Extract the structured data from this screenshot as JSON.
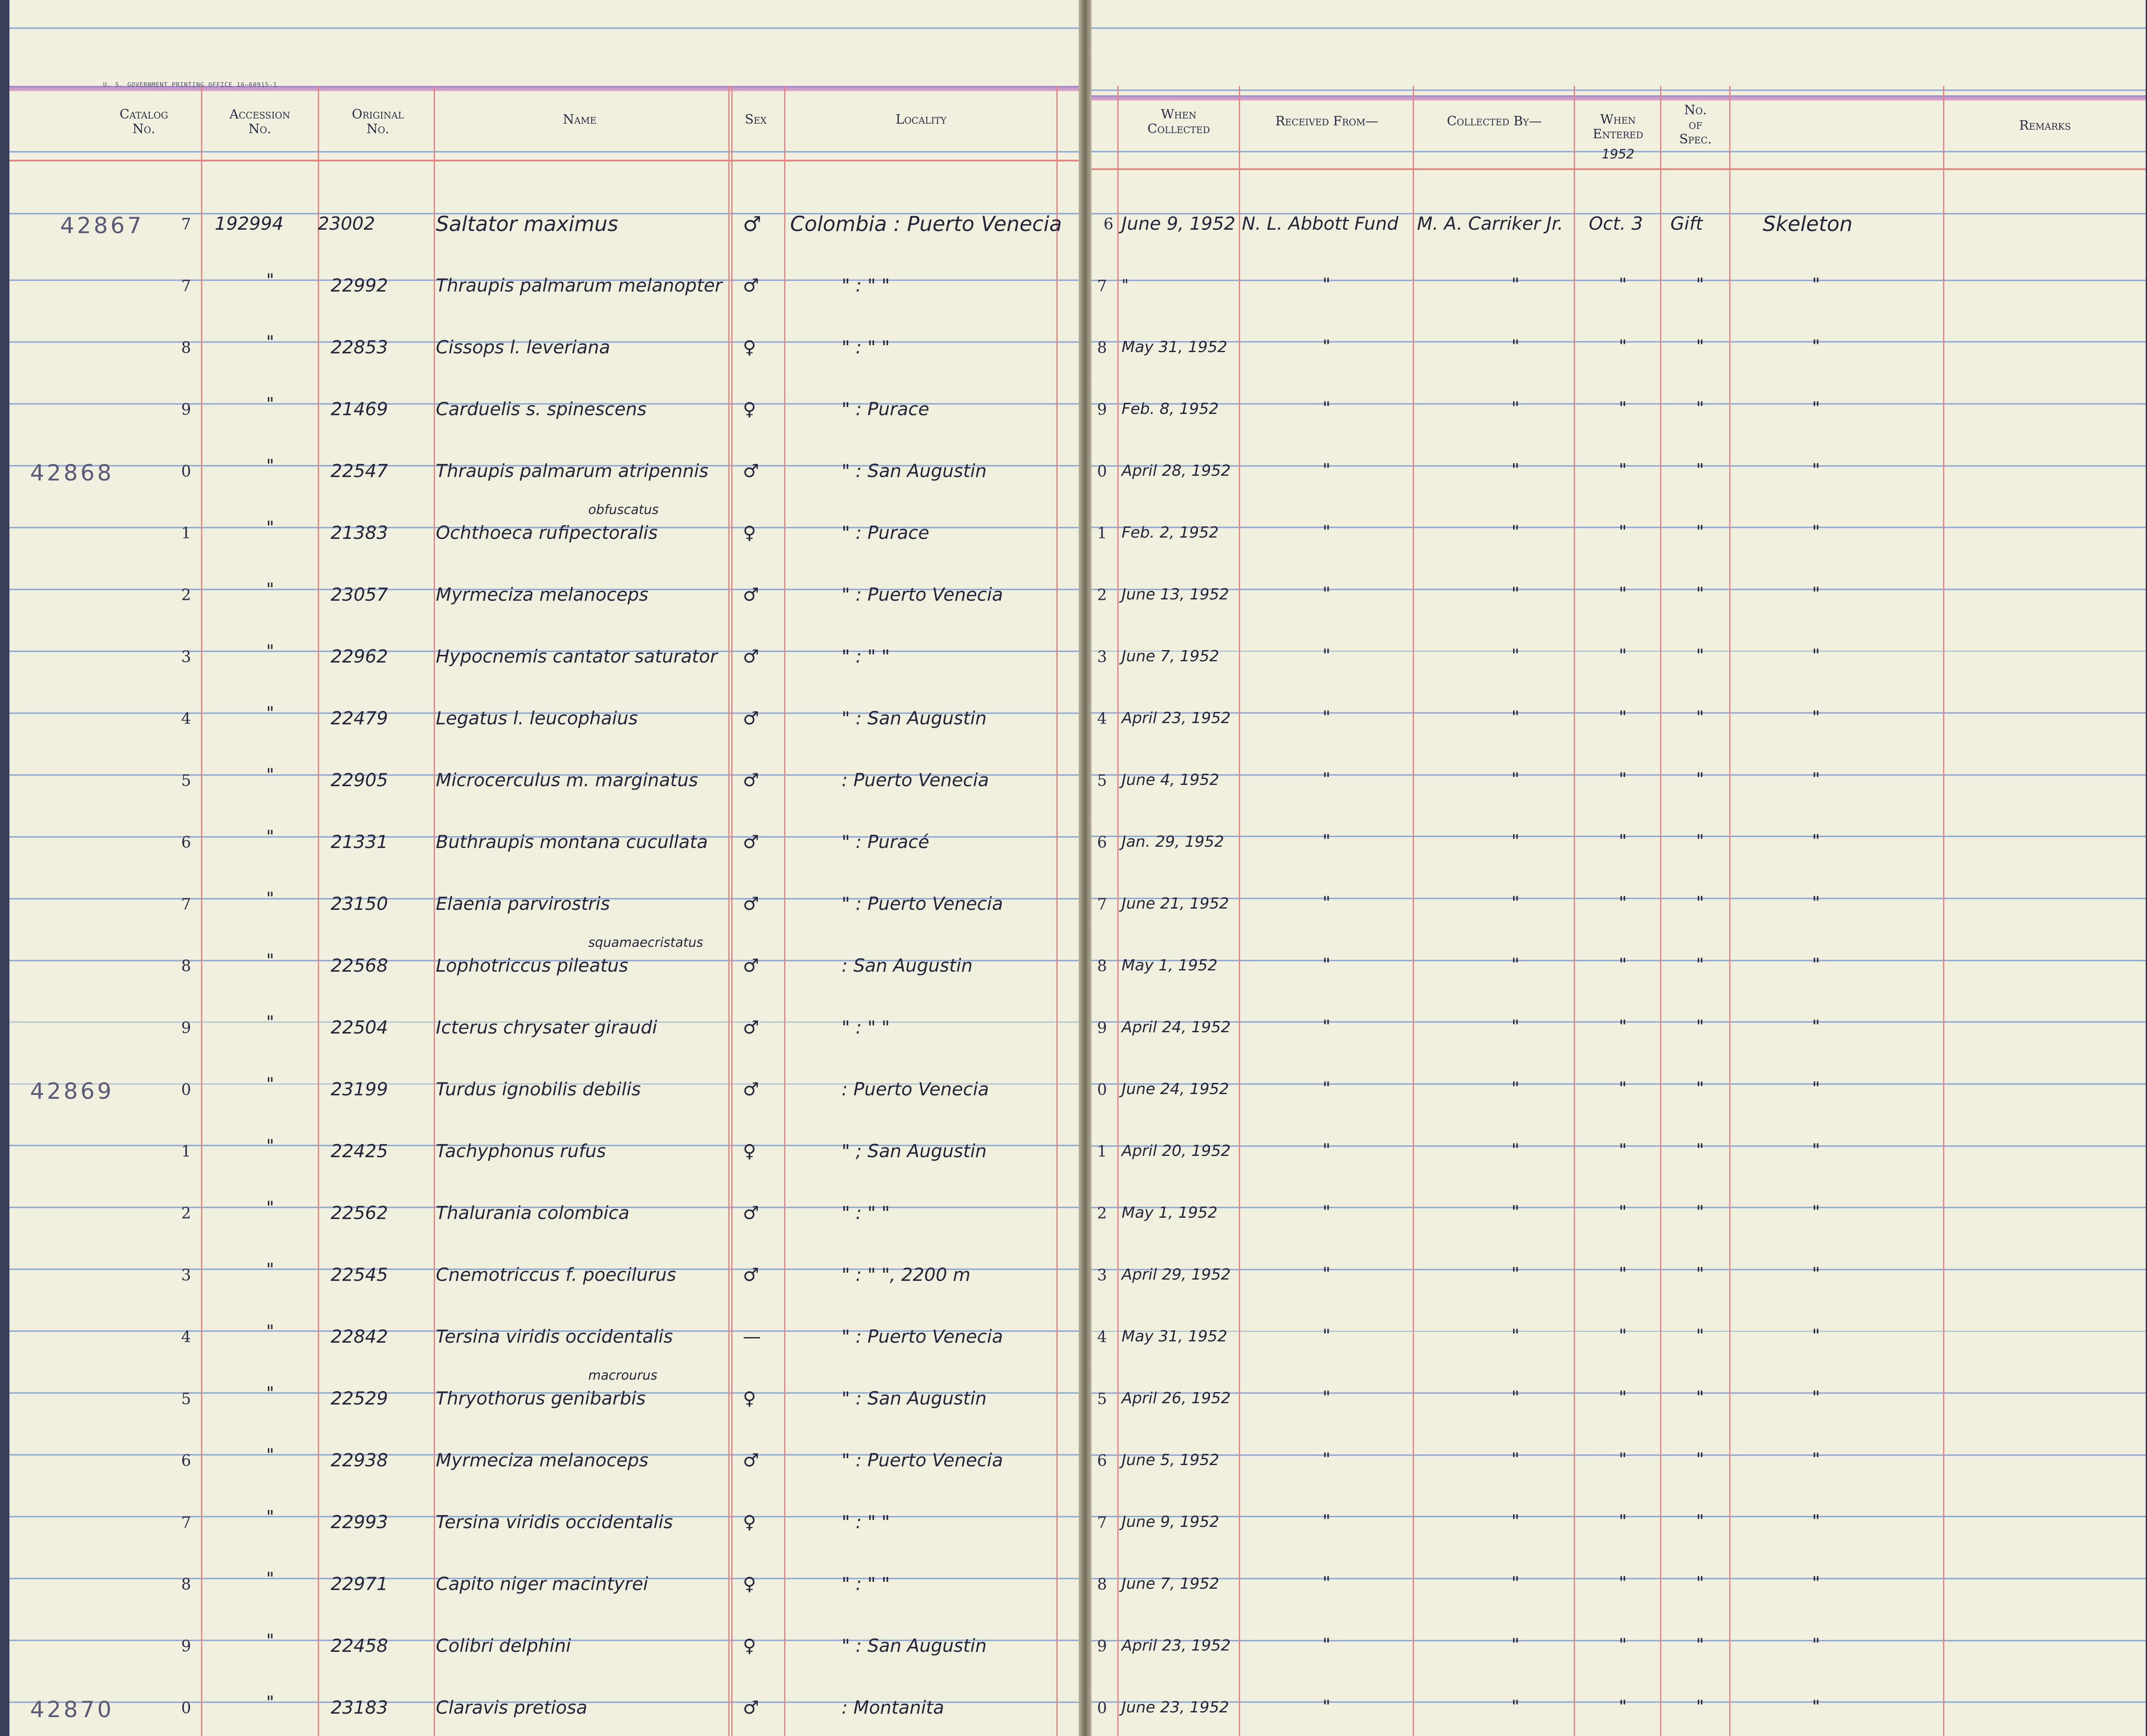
{
  "printer_line": "U. S. GOVERNMENT PRINTING OFFICE   16—60915-1",
  "headers": {
    "catalog": "Catalog\nNo.",
    "accession": "Accession\nNo.",
    "original": "Original\nNo.",
    "name": "Name",
    "sex": "Sex",
    "locality": "Locality",
    "when_collected": "When\nCollected",
    "received_from": "Received From—",
    "collected_by": "Collected By—",
    "when_entered": "When\nEntered",
    "no_of_spec": "No.\nof\nSpec.",
    "remarks": "Remarks"
  },
  "entered_year": "1952",
  "first_row": {
    "catalog_prefix": "42867",
    "accession": "192994",
    "original": "23002",
    "name": "Saltator maximus",
    "sex": "♂",
    "locality": "Colombia : Puerto Venecia",
    "right_digit": "6",
    "when_collected": "June 9, 1952",
    "received_from": "N. L. Abbott Fund",
    "collected_by": "M. A. Carriker Jr.",
    "when_entered": "Oct. 3",
    "spec": "Gift",
    "remarks": "Skeleton"
  },
  "rows": [
    {
      "catalog_prefix": "",
      "digit": "7",
      "original": "22992",
      "name": "Thraupis palmarum melanopter",
      "sex": "♂",
      "locality": "\"   :   \"   \"",
      "when_collected": "\""
    },
    {
      "catalog_prefix": "",
      "digit": "8",
      "original": "22853",
      "name": "Cissops l. leveriana",
      "sex": "♀",
      "locality": "\"   :   \"   \"",
      "when_collected": "May 31, 1952"
    },
    {
      "catalog_prefix": "",
      "digit": "9",
      "original": "21469",
      "name": "Carduelis s. spinescens",
      "sex": "♀",
      "locality": "\"  :  Purace",
      "when_collected": "Feb. 8, 1952"
    },
    {
      "catalog_prefix": "42868",
      "digit": "0",
      "original": "22547",
      "name": "Thraupis palmarum atripennis",
      "sex": "♂",
      "locality": "\"  :  San Augustin",
      "when_collected": "April 28, 1952"
    },
    {
      "catalog_prefix": "",
      "digit": "1",
      "original": "21383",
      "name": "Ochthoeca rufipectoralis",
      "interlinear": "obfuscatus",
      "sex": "♀",
      "locality": "\"  :  Purace",
      "when_collected": "Feb. 2, 1952"
    },
    {
      "catalog_prefix": "",
      "digit": "2",
      "original": "23057",
      "name": "Myrmeciza melanoceps",
      "sex": "♂",
      "locality": "\"  :  Puerto Venecia",
      "when_collected": "June 13, 1952"
    },
    {
      "catalog_prefix": "",
      "digit": "3",
      "original": "22962",
      "name": "Hypocnemis cantator saturator",
      "sex": "♂",
      "locality": "\"   :   \"   \"",
      "when_collected": "June 7, 1952"
    },
    {
      "catalog_prefix": "",
      "digit": "4",
      "original": "22479",
      "name": "Legatus l. leucophaius",
      "sex": "♂",
      "locality": "\"  :  San Augustin",
      "when_collected": "April 23, 1952"
    },
    {
      "catalog_prefix": "",
      "digit": "5",
      "original": "22905",
      "name": "Microcerculus m. marginatus",
      "sex": "♂",
      "locality": ":  Puerto Venecia",
      "when_collected": "June 4, 1952"
    },
    {
      "catalog_prefix": "",
      "digit": "6",
      "original": "21331",
      "name": "Buthraupis montana cucullata",
      "sex": "♂",
      "locality": "\"  :  Puracé",
      "when_collected": "Jan. 29, 1952"
    },
    {
      "catalog_prefix": "",
      "digit": "7",
      "original": "23150",
      "name": "Elaenia parvirostris",
      "sex": "♂",
      "locality": "\"  :  Puerto Venecia",
      "when_collected": "June 21, 1952"
    },
    {
      "catalog_prefix": "",
      "digit": "8",
      "original": "22568",
      "name": "Lophotriccus pileatus",
      "interlinear": "squamaecristatus",
      "sex": "♂",
      "locality": ":  San Augustin",
      "when_collected": "May 1, 1952"
    },
    {
      "catalog_prefix": "",
      "digit": "9",
      "original": "22504",
      "name": "Icterus chrysater giraudi",
      "sex": "♂",
      "locality": "\"  :   \"   \"",
      "when_collected": "April 24, 1952"
    },
    {
      "catalog_prefix": "42869",
      "digit": "0",
      "original": "23199",
      "name": "Turdus ignobilis debilis",
      "sex": "♂",
      "locality": ":  Puerto Venecia",
      "when_collected": "June 24, 1952"
    },
    {
      "catalog_prefix": "",
      "digit": "1",
      "original": "22425",
      "name": "Tachyphonus rufus",
      "sex": "♀",
      "locality": "\"  ;  San Augustin",
      "when_collected": "April 20, 1952"
    },
    {
      "catalog_prefix": "",
      "digit": "2",
      "original": "22562",
      "name": "Thalurania colombica",
      "sex": "♂",
      "locality": "\"  :  \"   \"",
      "when_collected": "May 1, 1952"
    },
    {
      "catalog_prefix": "",
      "digit": "3",
      "original": "22545",
      "name": "Cnemotriccus f. poecilurus",
      "sex": "♂",
      "locality": "\"  :  \"  \", 2200 m",
      "when_collected": "April 29, 1952"
    },
    {
      "catalog_prefix": "",
      "digit": "4",
      "original": "22842",
      "name": "Tersina viridis occidentalis",
      "sex": "—",
      "locality": "\"  :  Puerto Venecia",
      "when_collected": "May 31, 1952"
    },
    {
      "catalog_prefix": "",
      "digit": "5",
      "original": "22529",
      "name": "Thryothorus genibarbis",
      "interlinear": "macrourus",
      "sex": "♀",
      "locality": "\"  :  San Augustin",
      "when_collected": "April 26, 1952"
    },
    {
      "catalog_prefix": "",
      "digit": "6",
      "original": "22938",
      "name": "Myrmeciza melanoceps",
      "sex": "♂",
      "locality": "\"  :  Puerto Venecia",
      "when_collected": "June 5, 1952"
    },
    {
      "catalog_prefix": "",
      "digit": "7",
      "original": "22993",
      "name": "Tersina viridis occidentalis",
      "sex": "♀",
      "locality": "\"   :   \"   \"",
      "when_collected": "June 9, 1952"
    },
    {
      "catalog_prefix": "",
      "digit": "8",
      "original": "22971",
      "name": "Capito niger macintyrei",
      "sex": "♀",
      "locality": "\"   :   \"   \"",
      "when_collected": "June 7, 1952"
    },
    {
      "catalog_prefix": "",
      "digit": "9",
      "original": "22458",
      "name": "Colibri delphini",
      "sex": "♀",
      "locality": "\"  :  San Augustin",
      "when_collected": "April 23, 1952"
    },
    {
      "catalog_prefix": "42870",
      "digit": "0",
      "original": "23183",
      "name": "Claravis pretiosa",
      "sex": "♂",
      "locality": ":  Montanita",
      "when_collected": "June 23, 1952"
    }
  ],
  "ditto_mark": "\"",
  "colors": {
    "paper": "#f1efde",
    "rule_blue": "#86a3cf",
    "rule_red": "#e28585",
    "ink": "#25253a"
  }
}
